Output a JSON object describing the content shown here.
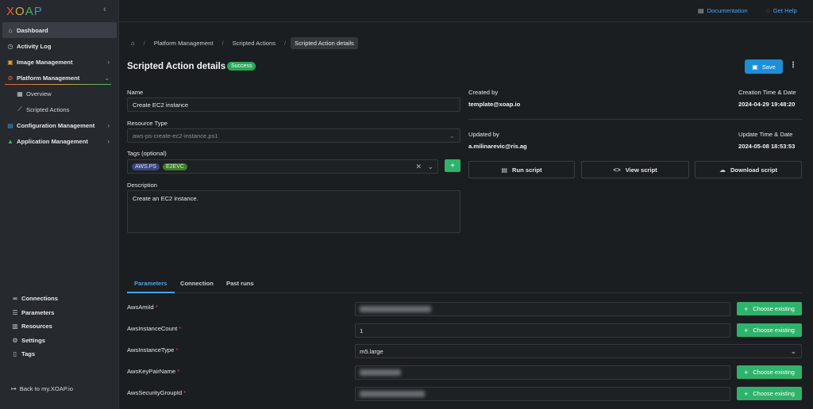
{
  "sidebar": {
    "logo_letters": [
      "X",
      "O",
      "A",
      "P"
    ],
    "logo_colors": [
      "#e0623a",
      "#d9a43a",
      "#47b26b",
      "#3d8fd6"
    ],
    "nav": [
      {
        "label": "Dashboard",
        "icon": "home-icon"
      },
      {
        "label": "Activity Log",
        "icon": "clock-icon"
      },
      {
        "label": "Image Management",
        "icon": "image-icon",
        "has_chevron": true
      },
      {
        "label": "Platform Management",
        "icon": "platform-icon",
        "has_chevron": true,
        "expanded": true
      },
      {
        "label": "Overview",
        "icon": "grid-icon",
        "sub": true
      },
      {
        "label": "Scripted Actions",
        "icon": "link-icon",
        "sub": true
      },
      {
        "label": "Configuration Management",
        "icon": "config-icon",
        "has_chevron": true
      },
      {
        "label": "Application Management",
        "icon": "app-icon",
        "has_chevron": true
      }
    ],
    "bottom_nav": [
      {
        "label": "Connections",
        "icon": "link-icon"
      },
      {
        "label": "Parameters",
        "icon": "list-icon"
      },
      {
        "label": "Resources",
        "icon": "box-icon"
      },
      {
        "label": "Settings",
        "icon": "gear-icon"
      },
      {
        "label": "Tags",
        "icon": "bookmark-icon"
      }
    ],
    "back_link": "Back to my.XOAP.io"
  },
  "topbar": {
    "documentation": "Documentation",
    "get_help": "Get Help"
  },
  "breadcrumb": [
    "Platform Management",
    "Scripted Actions",
    "Scripted Action details"
  ],
  "page": {
    "title": "Scripted Action details",
    "status": "Success",
    "save_label": "Save"
  },
  "form": {
    "name_label": "Name",
    "name_value": "Create EC2 instance",
    "resource_type_label": "Resource Type",
    "resource_type_value": "aws-ps-create-ec2-instance.ps1",
    "tags_label": "Tags (optional)",
    "tags": [
      "AWS.PS",
      "E2EVC"
    ],
    "description_label": "Description",
    "description_value": "Create an EC2 instance."
  },
  "info": {
    "created_by_label": "Created by",
    "created_by_value": "template@xoap.io",
    "creation_time_label": "Creation Time & Date",
    "creation_time_value": "2024-04-29 19:48:20",
    "updated_by_label": "Updated by",
    "updated_by_value": "a.milinarevic@ris.ag",
    "update_time_label": "Update Time & Date",
    "update_time_value": "2024-05-08 18:53:53"
  },
  "actions": {
    "run": "Run script",
    "view": "View script",
    "download": "Download script"
  },
  "tabs": [
    "Parameters",
    "Connection",
    "Past runs"
  ],
  "parameters": [
    {
      "name": "AwsAmiId",
      "value": "",
      "blurred": true,
      "choose": true
    },
    {
      "name": "AwsInstanceCount",
      "value": "1",
      "blurred": false,
      "choose": true
    },
    {
      "name": "AwsInstanceType",
      "value": "m5.large",
      "blurred": false,
      "choose": false
    },
    {
      "name": "AwsKeyPairName",
      "value": "",
      "blurred": true,
      "choose": true
    },
    {
      "name": "AwsSecurityGroupId",
      "value": "",
      "blurred": true,
      "choose": true
    }
  ],
  "choose_label": "Choose existing"
}
